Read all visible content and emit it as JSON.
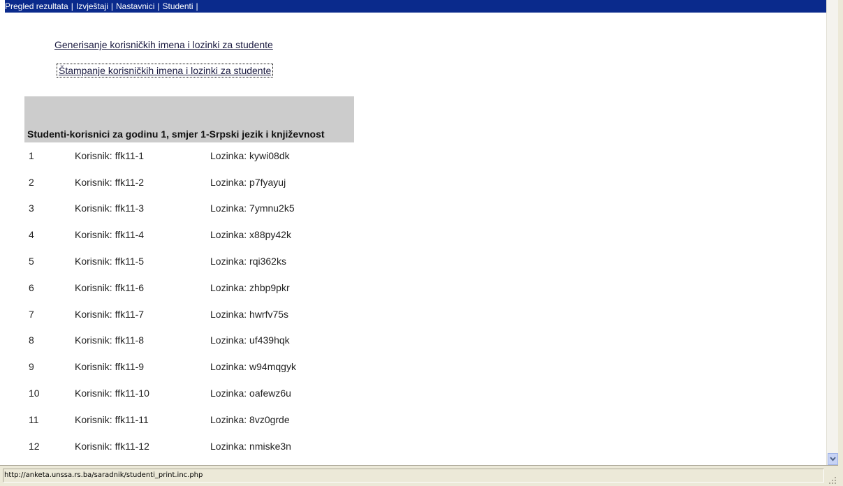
{
  "topnav": {
    "items": [
      "Pregled rezultata",
      "Izvještaji",
      "Nastavnici",
      "Studenti"
    ],
    "separator": "|"
  },
  "actions": {
    "generate_label": "Generisanje korisničkih imena i lozinki za studente",
    "print_label": "Štampanje korisničkih imena i lozinki za studente"
  },
  "table": {
    "heading": "Studenti-korisnici za godinu 1, smjer 1-Srpski jezik i književnost",
    "rows": [
      {
        "num": "1",
        "user": "Korisnik: ffk11-1",
        "pass": "Lozinka: kywi08dk"
      },
      {
        "num": "2",
        "user": "Korisnik: ffk11-2",
        "pass": "Lozinka: p7fyayuj"
      },
      {
        "num": "3",
        "user": "Korisnik: ffk11-3",
        "pass": "Lozinka: 7ymnu2k5"
      },
      {
        "num": "4",
        "user": "Korisnik: ffk11-4",
        "pass": "Lozinka: x88py42k"
      },
      {
        "num": "5",
        "user": "Korisnik: ffk11-5",
        "pass": "Lozinka: rqi362ks"
      },
      {
        "num": "6",
        "user": "Korisnik: ffk11-6",
        "pass": "Lozinka: zhbp9pkr"
      },
      {
        "num": "7",
        "user": "Korisnik: ffk11-7",
        "pass": "Lozinka: hwrfv75s"
      },
      {
        "num": "8",
        "user": "Korisnik: ffk11-8",
        "pass": "Lozinka: uf439hqk"
      },
      {
        "num": "9",
        "user": "Korisnik: ffk11-9",
        "pass": "Lozinka: w94mqgyk"
      },
      {
        "num": "10",
        "user": "Korisnik: ffk11-10",
        "pass": "Lozinka: oafewz6u"
      },
      {
        "num": "11",
        "user": "Korisnik: ffk11-11",
        "pass": "Lozinka: 8vz0grde"
      },
      {
        "num": "12",
        "user": "Korisnik: ffk11-12",
        "pass": "Lozinka: nmiske3n"
      }
    ]
  },
  "statusbar": {
    "url": "http://anketa.unssa.rs.ba/saradnik/studenti_print.inc.php"
  },
  "icons": {
    "scroll_down": "chevron-down-icon",
    "resize_grip": "resize-grip-icon"
  },
  "colors": {
    "nav_bg": "#0a2a8c",
    "header_bg": "#cccccc",
    "chrome_bg": "#ece9d8"
  }
}
